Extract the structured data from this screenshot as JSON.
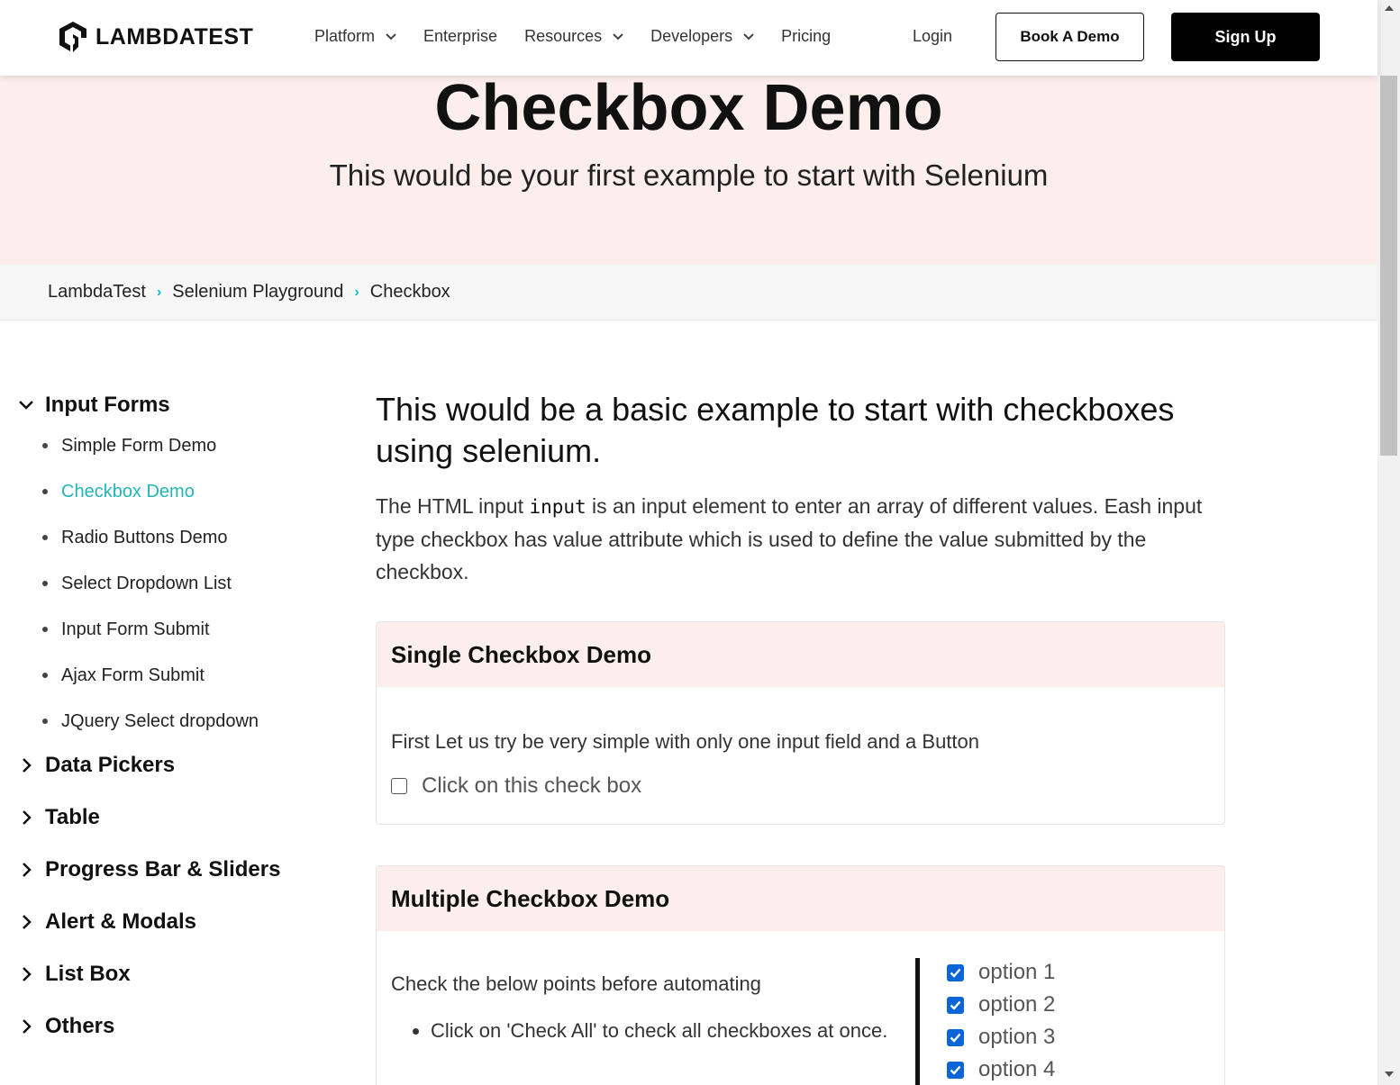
{
  "header": {
    "logo_text": "LAMBDATEST",
    "nav": [
      {
        "label": "Platform",
        "has_dropdown": true
      },
      {
        "label": "Enterprise",
        "has_dropdown": false
      },
      {
        "label": "Resources",
        "has_dropdown": true
      },
      {
        "label": "Developers",
        "has_dropdown": true
      },
      {
        "label": "Pricing",
        "has_dropdown": false
      }
    ],
    "login_label": "Login",
    "book_demo_label": "Book A Demo",
    "signup_label": "Sign Up"
  },
  "hero": {
    "title": "Checkbox Demo",
    "subtitle": "This would be your first example to start with Selenium"
  },
  "breadcrumb": [
    "LambdaTest",
    "Selenium Playground",
    "Checkbox"
  ],
  "sidebar": {
    "open_group": "Input Forms",
    "items": [
      "Simple Form Demo",
      "Checkbox Demo",
      "Radio Buttons Demo",
      "Select Dropdown List",
      "Input Form Submit",
      "Ajax Form Submit",
      "JQuery Select dropdown"
    ],
    "active_item": "Checkbox Demo",
    "closed_groups": [
      "Data Pickers",
      "Table",
      "Progress Bar & Sliders",
      "Alert & Modals",
      "List Box",
      "Others"
    ]
  },
  "main": {
    "heading": "This would be a basic example to start with checkboxes using selenium.",
    "intro_part1": "The HTML input ",
    "intro_code": "input",
    "intro_part2": " is an input element to enter an array of different values. Eash input type checkbox has value attribute which is used to define the value submitted by the checkbox."
  },
  "single_checkbox": {
    "title": "Single Checkbox Demo",
    "description": "First Let us try be very simple with only one input field and a Button",
    "checkbox_label": "Click on this check box",
    "checked": false
  },
  "multiple_checkbox": {
    "title": "Multiple Checkbox Demo",
    "description": "Check the below points before automating",
    "points": [
      "Click on 'Check All' to check all checkboxes at once."
    ],
    "options": [
      {
        "label": "option 1",
        "checked": true
      },
      {
        "label": "option 2",
        "checked": true
      },
      {
        "label": "option 3",
        "checked": true
      },
      {
        "label": "option 4",
        "checked": true
      }
    ]
  },
  "colors": {
    "accent": "#23b5b5",
    "hero_bg": "#fdeeee",
    "checkbox_blue": "#0a66d6"
  }
}
